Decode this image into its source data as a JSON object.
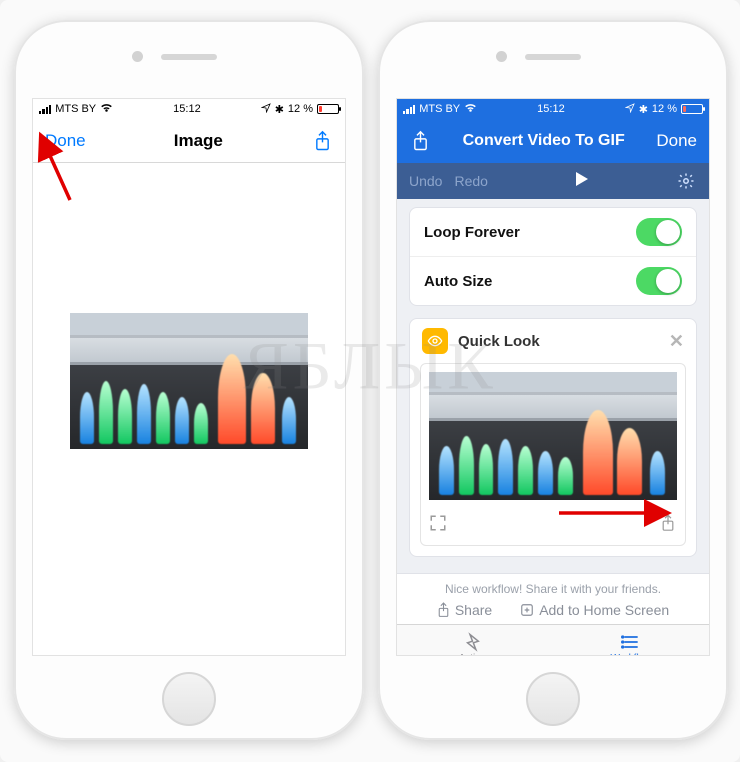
{
  "status": {
    "carrier": "MTS BY",
    "time": "15:12",
    "battery_text": "12 %",
    "battery_fill_pct": 14
  },
  "left": {
    "done": "Done",
    "title": "Image"
  },
  "right": {
    "navtitle": "Convert Video To GIF",
    "done": "Done",
    "undo": "Undo",
    "redo": "Redo",
    "opts": {
      "loop": "Loop Forever",
      "autosize": "Auto Size"
    },
    "quicklook": "Quick Look",
    "footer_msg": "Nice workflow! Share it with your friends.",
    "share": "Share",
    "addhome": "Add to Home Screen",
    "tab_actions": "Actions",
    "tab_workflow": "Workflow"
  },
  "watermark": "ЯБЛЫК"
}
